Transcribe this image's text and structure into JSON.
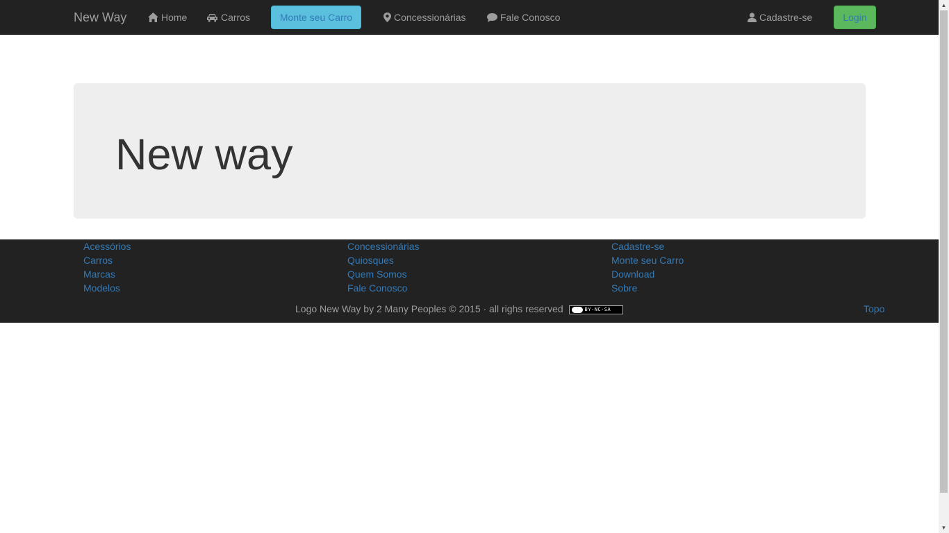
{
  "navbar": {
    "brand": "New Way",
    "home": "Home",
    "cars": "Carros",
    "build_car": "Monte seu Carro",
    "dealers": "Concessionárias",
    "contact": "Fale Conosco",
    "signup": "Cadastre-se",
    "login": "Login"
  },
  "jumbotron": {
    "title": "New way"
  },
  "footer": {
    "col1": [
      "Acessórios",
      "Carros",
      "Marcas",
      "Modelos"
    ],
    "col2": [
      "Concessionárias",
      "Quiosques",
      "Quem Somos",
      "Fale Conosco"
    ],
    "col3": [
      "Cadastre-se",
      "Monte seu Carro",
      "Download",
      "Sobre"
    ],
    "copyright": "Logo New Way by 2 Many Peoples © 2015 · all righs reserved",
    "license_badge": "BY-NC-SA",
    "top_link": "Topo"
  },
  "icons": {
    "home": "home-icon",
    "car": "car-icon",
    "map_marker": "map-marker-icon",
    "comment": "comment-icon",
    "user": "user-icon"
  },
  "colors": {
    "navbar_bg": "#222222",
    "link": "#337ab7",
    "info_button": "#5bc0de",
    "success_button": "#5cb85c",
    "jumbotron_bg": "#eeeeee"
  }
}
